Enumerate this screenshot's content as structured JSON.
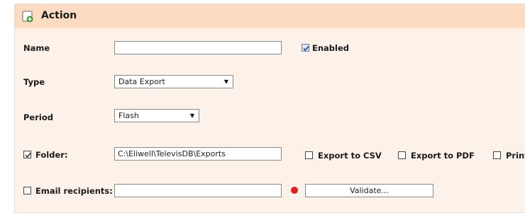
{
  "panel": {
    "title": "Action"
  },
  "fields": {
    "name_label": "Name",
    "name_value": "",
    "enabled_label": "Enabled",
    "enabled_checked": true,
    "type_label": "Type",
    "type_value": "Data Export",
    "period_label": "Period",
    "period_value": "Flash",
    "folder_label": "Folder:",
    "folder_checked": true,
    "folder_value": "C:\\Eliwell\\TelevisDB\\Exports",
    "export_csv_label": "Export to CSV",
    "export_pdf_label": "Export to PDF",
    "print_label": "Print",
    "email_label": "Email recipients:",
    "email_checked": false,
    "email_value": "",
    "validate_label": "Validate...",
    "status_color": "#e02020"
  },
  "colors": {
    "panel_bg": "#fdf2e9",
    "header_bg": "#fbdcc3",
    "accent_green": "#3a9a2e"
  }
}
